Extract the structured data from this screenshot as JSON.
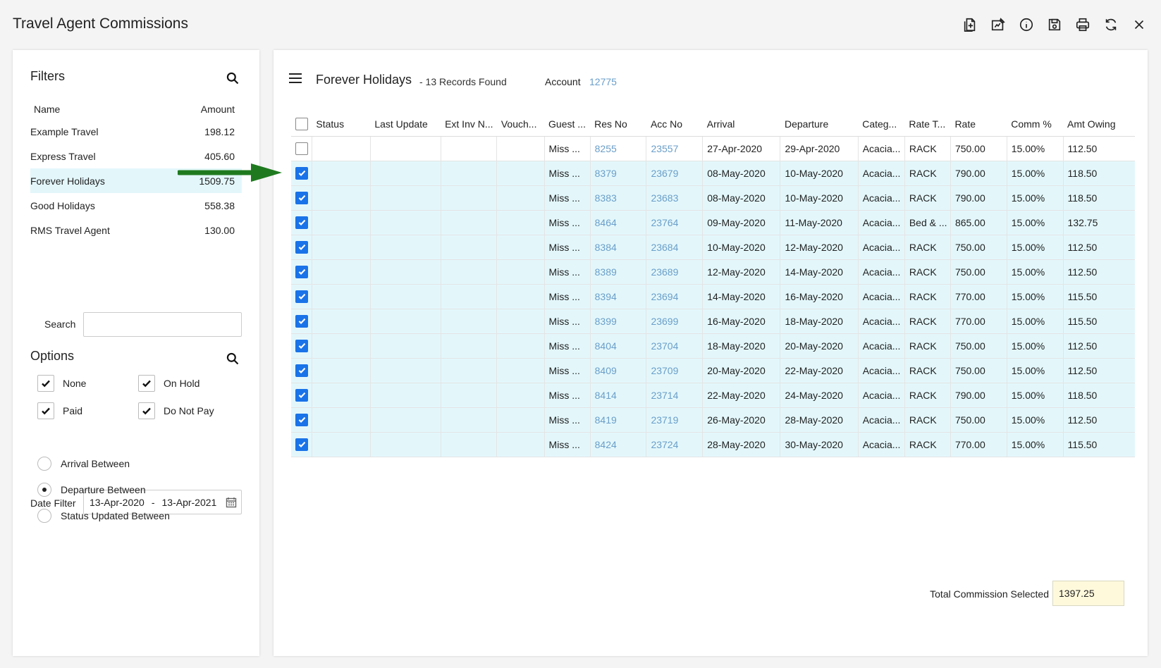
{
  "app": {
    "title": "Travel Agent Commissions"
  },
  "toolbar": {
    "buttons": [
      {
        "name": "add-document-icon"
      },
      {
        "name": "edit-icon"
      },
      {
        "name": "info-icon"
      },
      {
        "name": "save-icon"
      },
      {
        "name": "print-icon"
      },
      {
        "name": "refresh-icon"
      },
      {
        "name": "close-icon"
      }
    ]
  },
  "filters": {
    "title": "Filters",
    "columns": {
      "name": "Name",
      "amount": "Amount"
    },
    "items": [
      {
        "name": "Example Travel",
        "amount": "198.12",
        "selected": false
      },
      {
        "name": "Express Travel",
        "amount": "405.60",
        "selected": false
      },
      {
        "name": "Forever Holidays",
        "amount": "1509.75",
        "selected": true
      },
      {
        "name": "Good Holidays",
        "amount": "558.38",
        "selected": false
      },
      {
        "name": "RMS Travel Agent",
        "amount": "130.00",
        "selected": false
      }
    ],
    "search_label": "Search",
    "search_value": ""
  },
  "options": {
    "title": "Options",
    "checkboxes": [
      {
        "label": "None",
        "checked": true
      },
      {
        "label": "On Hold",
        "checked": true
      },
      {
        "label": "Paid",
        "checked": true
      },
      {
        "label": "Do Not Pay",
        "checked": true
      }
    ],
    "date_filter_label": "Date Filter",
    "date_from": "13-Apr-2020",
    "date_sep": "-",
    "date_to": "13-Apr-2021",
    "radios": [
      {
        "label": "Arrival Between",
        "selected": false
      },
      {
        "label": "Departure Between",
        "selected": true
      },
      {
        "label": "Status Updated Between",
        "selected": false
      }
    ]
  },
  "main": {
    "title": "Forever Holidays",
    "records": "- 13 Records Found",
    "account_label": "Account",
    "account_value": "12775",
    "columns": [
      "Status",
      "Last Update",
      "Ext Inv N...",
      "Vouch...",
      "Guest ...",
      "Res No",
      "Acc No",
      "Arrival",
      "Departure",
      "Categ...",
      "Rate T...",
      "Rate",
      "Comm %",
      "Amt Owing"
    ],
    "rows": [
      {
        "checked": false,
        "guest": "Miss ...",
        "res": "8255",
        "acc": "23557",
        "arrival": "27-Apr-2020",
        "departure": "29-Apr-2020",
        "category": "Acacia...",
        "rate_type": "RACK",
        "rate": "750.00",
        "comm": "15.00%",
        "owing": "112.50"
      },
      {
        "checked": true,
        "guest": "Miss ...",
        "res": "8379",
        "acc": "23679",
        "arrival": "08-May-2020",
        "departure": "10-May-2020",
        "category": "Acacia...",
        "rate_type": "RACK",
        "rate": "790.00",
        "comm": "15.00%",
        "owing": "118.50"
      },
      {
        "checked": true,
        "guest": "Miss ...",
        "res": "8383",
        "acc": "23683",
        "arrival": "08-May-2020",
        "departure": "10-May-2020",
        "category": "Acacia...",
        "rate_type": "RACK",
        "rate": "790.00",
        "comm": "15.00%",
        "owing": "118.50"
      },
      {
        "checked": true,
        "guest": "Miss ...",
        "res": "8464",
        "acc": "23764",
        "arrival": "09-May-2020",
        "departure": "11-May-2020",
        "category": "Acacia...",
        "rate_type": "Bed & ...",
        "rate": "865.00",
        "comm": "15.00%",
        "owing": "132.75"
      },
      {
        "checked": true,
        "guest": "Miss ...",
        "res": "8384",
        "acc": "23684",
        "arrival": "10-May-2020",
        "departure": "12-May-2020",
        "category": "Acacia...",
        "rate_type": "RACK",
        "rate": "750.00",
        "comm": "15.00%",
        "owing": "112.50"
      },
      {
        "checked": true,
        "guest": "Miss ...",
        "res": "8389",
        "acc": "23689",
        "arrival": "12-May-2020",
        "departure": "14-May-2020",
        "category": "Acacia...",
        "rate_type": "RACK",
        "rate": "750.00",
        "comm": "15.00%",
        "owing": "112.50"
      },
      {
        "checked": true,
        "guest": "Miss ...",
        "res": "8394",
        "acc": "23694",
        "arrival": "14-May-2020",
        "departure": "16-May-2020",
        "category": "Acacia...",
        "rate_type": "RACK",
        "rate": "770.00",
        "comm": "15.00%",
        "owing": "115.50"
      },
      {
        "checked": true,
        "guest": "Miss ...",
        "res": "8399",
        "acc": "23699",
        "arrival": "16-May-2020",
        "departure": "18-May-2020",
        "category": "Acacia...",
        "rate_type": "RACK",
        "rate": "770.00",
        "comm": "15.00%",
        "owing": "115.50"
      },
      {
        "checked": true,
        "guest": "Miss ...",
        "res": "8404",
        "acc": "23704",
        "arrival": "18-May-2020",
        "departure": "20-May-2020",
        "category": "Acacia...",
        "rate_type": "RACK",
        "rate": "750.00",
        "comm": "15.00%",
        "owing": "112.50"
      },
      {
        "checked": true,
        "guest": "Miss ...",
        "res": "8409",
        "acc": "23709",
        "arrival": "20-May-2020",
        "departure": "22-May-2020",
        "category": "Acacia...",
        "rate_type": "RACK",
        "rate": "750.00",
        "comm": "15.00%",
        "owing": "112.50"
      },
      {
        "checked": true,
        "guest": "Miss ...",
        "res": "8414",
        "acc": "23714",
        "arrival": "22-May-2020",
        "departure": "24-May-2020",
        "category": "Acacia...",
        "rate_type": "RACK",
        "rate": "790.00",
        "comm": "15.00%",
        "owing": "118.50"
      },
      {
        "checked": true,
        "guest": "Miss ...",
        "res": "8419",
        "acc": "23719",
        "arrival": "26-May-2020",
        "departure": "28-May-2020",
        "category": "Acacia...",
        "rate_type": "RACK",
        "rate": "750.00",
        "comm": "15.00%",
        "owing": "112.50"
      },
      {
        "checked": true,
        "guest": "Miss ...",
        "res": "8424",
        "acc": "23724",
        "arrival": "28-May-2020",
        "departure": "30-May-2020",
        "category": "Acacia...",
        "rate_type": "RACK",
        "rate": "770.00",
        "comm": "15.00%",
        "owing": "115.50"
      }
    ],
    "total_label": "Total Commission Selected",
    "total_value": "1397.25"
  },
  "colors": {
    "link": "#6a9ec9",
    "selected_row": "#e3f7fb",
    "checkbox": "#1a73e8",
    "arrow": "#1f7a1f",
    "total_bg": "#fff9dc"
  }
}
